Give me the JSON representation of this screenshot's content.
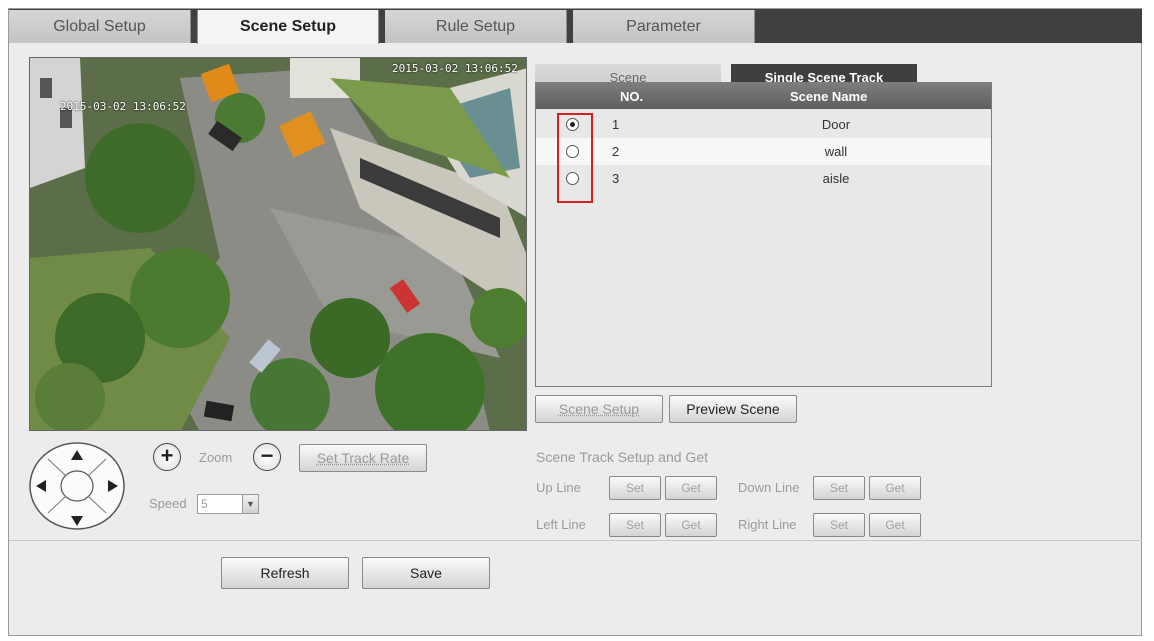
{
  "tabs": [
    "Global Setup",
    "Scene Setup",
    "Rule Setup",
    "Parameter"
  ],
  "video": {
    "timestamp": "2015-03-02 13:06:52",
    "camera_label": "2015-03-02 13:06:52"
  },
  "ptz": {
    "zoom_label": "Zoom",
    "zoom_in_symbol": "+",
    "zoom_out_symbol": "−",
    "set_track_rate_label": "Set Track Rate",
    "speed_label": "Speed",
    "speed_value": "5"
  },
  "scene_tabs": [
    "Scene",
    "Single Scene Track"
  ],
  "scene_table": {
    "headers": [
      "NO.",
      "Scene Name"
    ],
    "rows": [
      {
        "no": "1",
        "name": "Door",
        "selected": true
      },
      {
        "no": "2",
        "name": "wall",
        "selected": false
      },
      {
        "no": "3",
        "name": "aisle",
        "selected": false
      }
    ]
  },
  "scene_buttons": {
    "scene_setup": "Scene Setup",
    "preview_scene": "Preview Scene"
  },
  "track": {
    "title": "Scene Track Setup and Get",
    "up_line": "Up Line",
    "down_line": "Down Line",
    "left_line": "Left Line",
    "right_line": "Right Line",
    "set_label": "Set",
    "get_label": "Get"
  },
  "footer": {
    "refresh": "Refresh",
    "save": "Save"
  },
  "colors": {
    "highlight": "#d42020",
    "tab_active_bg": "#3f3f3f"
  }
}
